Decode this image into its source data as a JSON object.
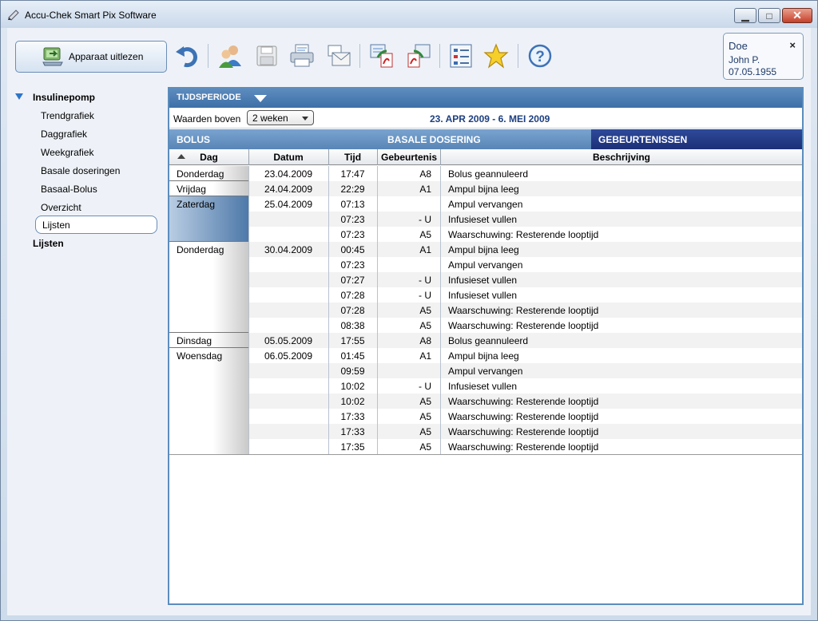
{
  "window": {
    "title": "Accu-Chek Smart Pix Software",
    "min": "▁",
    "max": "□",
    "close": "✕"
  },
  "toolbar": {
    "read_label": "Apparaat uitlezen"
  },
  "patient": {
    "name": "Doe",
    "first": "John P.",
    "dob": "07.05.1955",
    "close": "×"
  },
  "nav": {
    "group1": "Insulinepomp",
    "items": [
      "Trendgrafiek",
      "Daggrafiek",
      "Weekgrafiek",
      "Basale doseringen",
      "Basaal-Bolus",
      "Overzicht",
      "Lijsten"
    ],
    "group2": "Lijsten"
  },
  "panel": {
    "period_label": "TIJDSPERIODE",
    "filter_label": "Waarden boven",
    "filter_value": "2 weken",
    "range": "23. APR 2009 - 6. MEI 2009",
    "tabs": [
      "BOLUS",
      "BASALE DOSERING",
      "GEBEURTENISSEN"
    ]
  },
  "table": {
    "headers": [
      "Dag",
      "Datum",
      "Tijd",
      "Gebeurtenis",
      "Beschrijving"
    ],
    "rows": [
      [
        "Donderdag",
        "23.04.2009",
        "17:47",
        "A8",
        "Bolus geannuleerd"
      ],
      [
        "Vrijdag",
        "24.04.2009",
        "22:29",
        "A1",
        "Ampul bijna leeg"
      ],
      [
        "Zaterdag",
        "25.04.2009",
        "07:13",
        "",
        "Ampul vervangen"
      ],
      [
        "",
        "",
        "07:23",
        "- U",
        "Infusieset vullen"
      ],
      [
        "",
        "",
        "07:23",
        "A5",
        "Waarschuwing: Resterende looptijd"
      ],
      [
        "Donderdag",
        "30.04.2009",
        "00:45",
        "A1",
        "Ampul bijna leeg"
      ],
      [
        "",
        "",
        "07:23",
        "",
        "Ampul vervangen"
      ],
      [
        "",
        "",
        "07:27",
        "- U",
        "Infusieset vullen"
      ],
      [
        "",
        "",
        "07:28",
        "- U",
        "Infusieset vullen"
      ],
      [
        "",
        "",
        "07:28",
        "A5",
        "Waarschuwing: Resterende looptijd"
      ],
      [
        "",
        "",
        "08:38",
        "A5",
        "Waarschuwing: Resterende looptijd"
      ],
      [
        "Dinsdag",
        "05.05.2009",
        "17:55",
        "A8",
        "Bolus geannuleerd"
      ],
      [
        "Woensdag",
        "06.05.2009",
        "01:45",
        "A1",
        "Ampul bijna leeg"
      ],
      [
        "",
        "",
        "09:59",
        "",
        "Ampul vervangen"
      ],
      [
        "",
        "",
        "10:02",
        "- U",
        "Infusieset vullen"
      ],
      [
        "",
        "",
        "10:02",
        "A5",
        "Waarschuwing: Resterende looptijd"
      ],
      [
        "",
        "",
        "17:33",
        "A5",
        "Waarschuwing: Resterende looptijd"
      ],
      [
        "",
        "",
        "17:33",
        "A5",
        "Waarschuwing: Resterende looptijd"
      ],
      [
        "",
        "",
        "17:35",
        "A5",
        "Waarschuwing: Resterende looptijd"
      ]
    ]
  },
  "icons": [
    "undo-icon",
    "patient-icon",
    "save-icon",
    "print-icon",
    "email-icon",
    "export-pdf-icon",
    "export-pdf2-icon",
    "checklist-icon",
    "favorite-icon",
    "help-icon"
  ]
}
